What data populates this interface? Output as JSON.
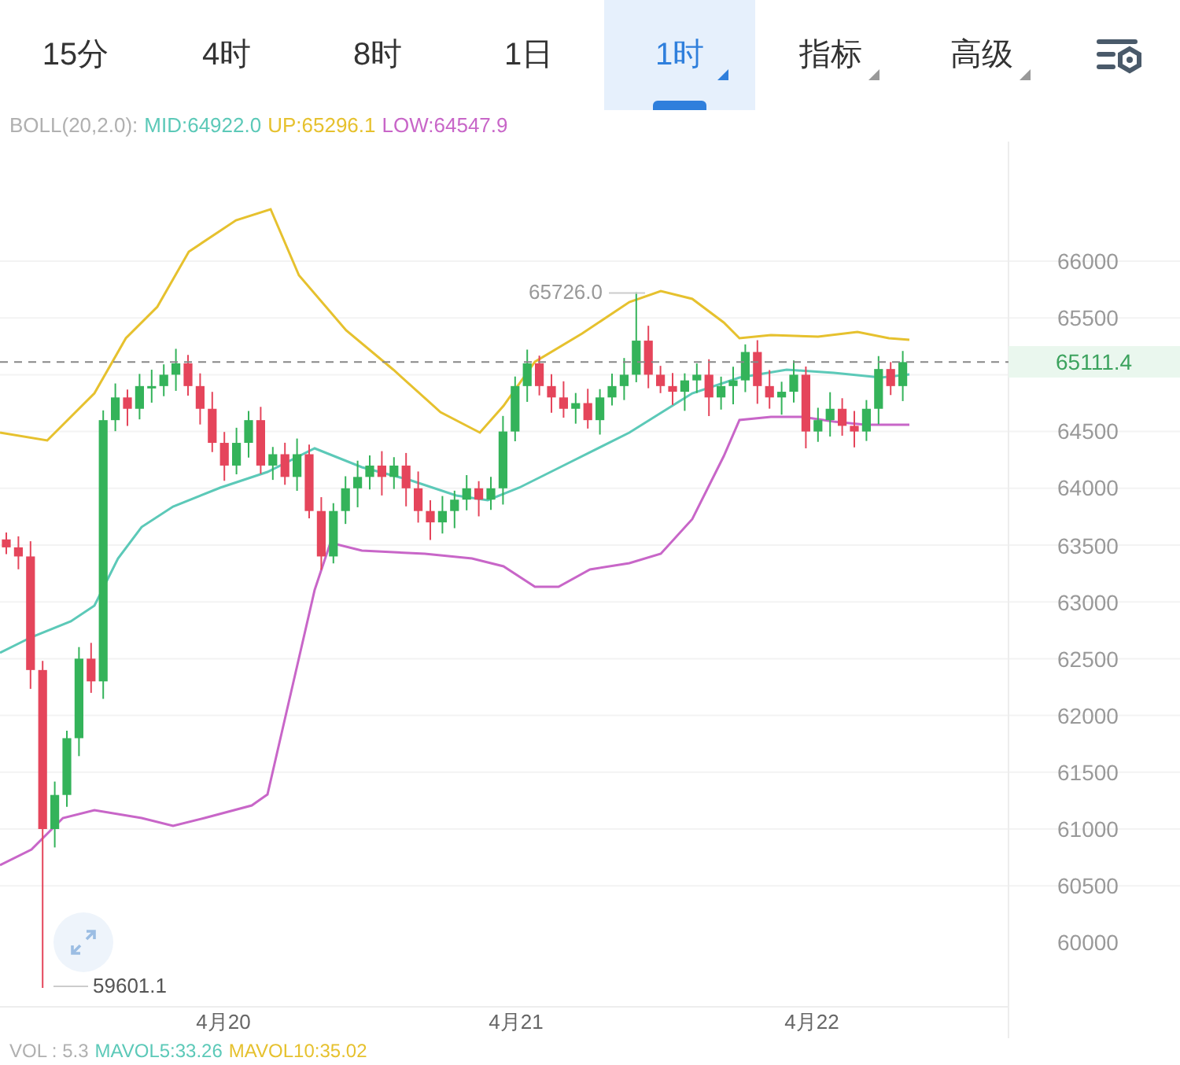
{
  "tabs": [
    {
      "label": "15分",
      "selected": false,
      "has_menu": false
    },
    {
      "label": "4时",
      "selected": false,
      "has_menu": false
    },
    {
      "label": "8时",
      "selected": false,
      "has_menu": false
    },
    {
      "label": "1日",
      "selected": false,
      "has_menu": false
    },
    {
      "label": "1时",
      "selected": true,
      "has_menu": true
    },
    {
      "label": "指标",
      "selected": false,
      "has_menu": true
    },
    {
      "label": "高级",
      "selected": false,
      "has_menu": true
    }
  ],
  "legend": [
    {
      "text": "BOLL(20,2.0):",
      "color": "#b0b0b0"
    },
    {
      "text": "MID:64922.0",
      "color": "#5cc9b8"
    },
    {
      "text": "UP:65296.1",
      "color": "#e6c12e"
    },
    {
      "text": "LOW:64547.9",
      "color": "#c866c8"
    }
  ],
  "price_axis": [
    "66000",
    "65500",
    "64500",
    "64000",
    "63500",
    "63000",
    "62500",
    "62000",
    "61500",
    "61000",
    "60500",
    "60000"
  ],
  "current_price": "65111.4",
  "high_label": "65726.0",
  "low_label": "59601.1",
  "time_axis": [
    "4月20",
    "4月21",
    "4月22"
  ],
  "volume_legend": [
    {
      "text": "VOL : 5.3",
      "color": "#b0b0b0"
    },
    {
      "text": "MAVOL5:33.26",
      "color": "#5cc9b8"
    },
    {
      "text": "MAVOL10:35.02",
      "color": "#e6c12e"
    }
  ]
}
